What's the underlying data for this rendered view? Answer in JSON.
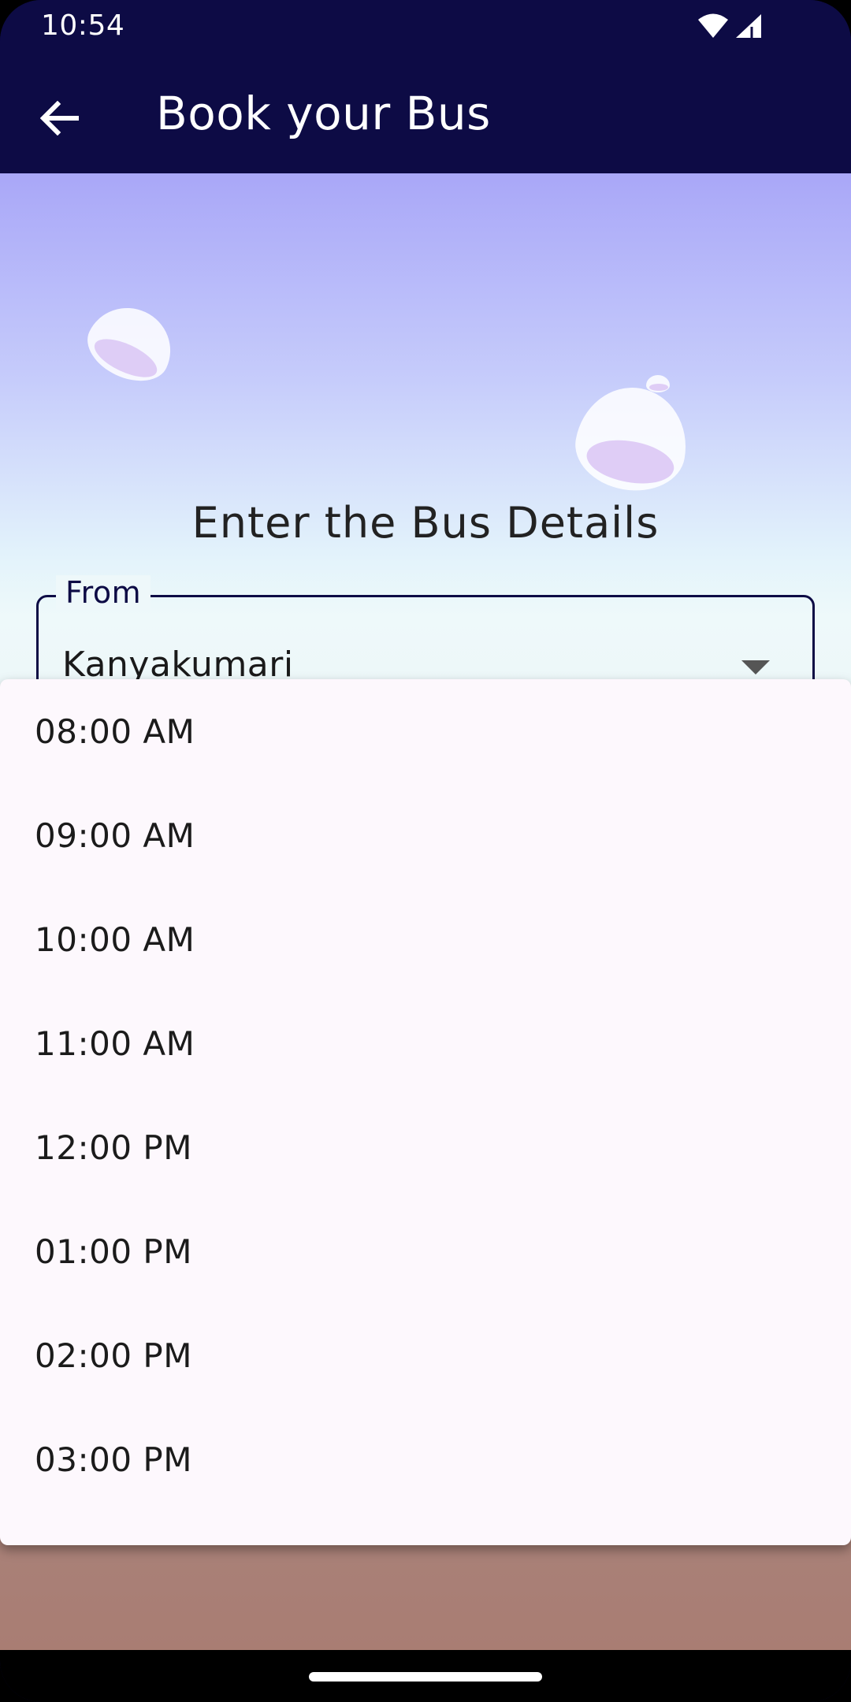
{
  "status_bar": {
    "time": "10:54",
    "icons": [
      "wifi-icon",
      "signal-icon"
    ]
  },
  "app_bar": {
    "title": "Book your Bus",
    "back_icon": "arrow-left-icon"
  },
  "main": {
    "heading": "Enter the Bus Details",
    "from_field": {
      "label": "From",
      "value": "Kanyakumari",
      "icon": "dropdown-arrow-icon"
    }
  },
  "time_menu": {
    "options": [
      "08:00 AM",
      "09:00 AM",
      "10:00 AM",
      "11:00 AM",
      "12:00 PM",
      "01:00 PM",
      "02:00 PM",
      "03:00 PM"
    ]
  },
  "colors": {
    "app_bar": "#0d0b45",
    "menu_background": "#fdf8fd",
    "text": "#1b1b1b"
  }
}
